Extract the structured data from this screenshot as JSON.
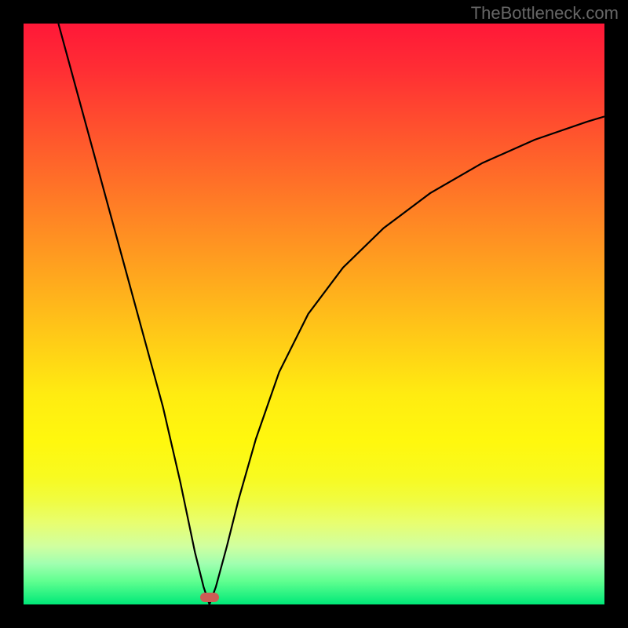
{
  "watermark": "TheBottleneck.com",
  "chart_data": {
    "type": "line",
    "title": "",
    "xlabel": "",
    "ylabel": "",
    "xlim": [
      0,
      1
    ],
    "ylim": [
      0,
      1
    ],
    "background": "rainbow-gradient-red-to-green",
    "series": [
      {
        "name": "bottleneck-curve",
        "description": "V-shaped curve with steep left descent, vertex near x≈0.32, asymptotic right ascent",
        "x": [
          0.06,
          0.09,
          0.12,
          0.15,
          0.18,
          0.21,
          0.24,
          0.27,
          0.295,
          0.31,
          0.32,
          0.331,
          0.35,
          0.37,
          0.4,
          0.44,
          0.49,
          0.55,
          0.62,
          0.7,
          0.79,
          0.88,
          0.97,
          1.0
        ],
        "y": [
          1.0,
          0.89,
          0.78,
          0.67,
          0.56,
          0.45,
          0.34,
          0.21,
          0.09,
          0.03,
          0.0,
          0.03,
          0.1,
          0.18,
          0.285,
          0.4,
          0.5,
          0.58,
          0.648,
          0.708,
          0.76,
          0.8,
          0.831,
          0.84
        ]
      }
    ],
    "vertex_marker": {
      "x": 0.32,
      "y": 0.012,
      "color": "#cc5d55"
    }
  },
  "layout": {
    "frame_color": "#000000",
    "frame_thickness": 30,
    "plot_size": 740
  }
}
